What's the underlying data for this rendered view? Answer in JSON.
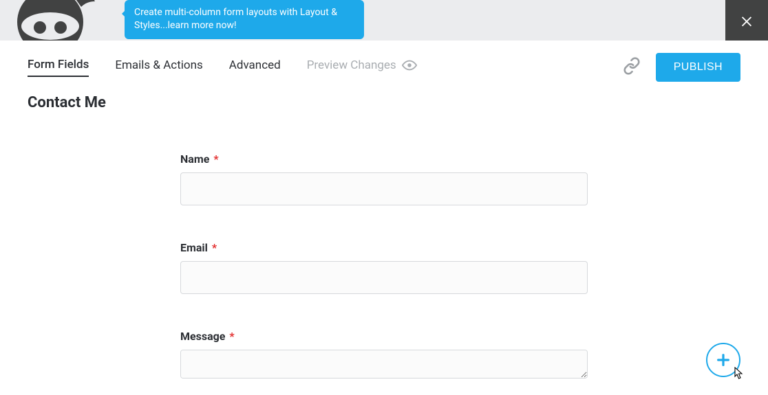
{
  "tooltip": {
    "text": "Create multi-column form layouts with Layout & Styles...learn more now!"
  },
  "tabs": {
    "form_fields": "Form Fields",
    "emails_actions": "Emails & Actions",
    "advanced": "Advanced",
    "preview": "Preview Changes"
  },
  "actions": {
    "publish": "PUBLISH"
  },
  "form": {
    "title": "Contact Me",
    "fields": {
      "name": {
        "label": "Name",
        "required": "*"
      },
      "email": {
        "label": "Email",
        "required": "*"
      },
      "message": {
        "label": "Message",
        "required": "*"
      }
    }
  }
}
